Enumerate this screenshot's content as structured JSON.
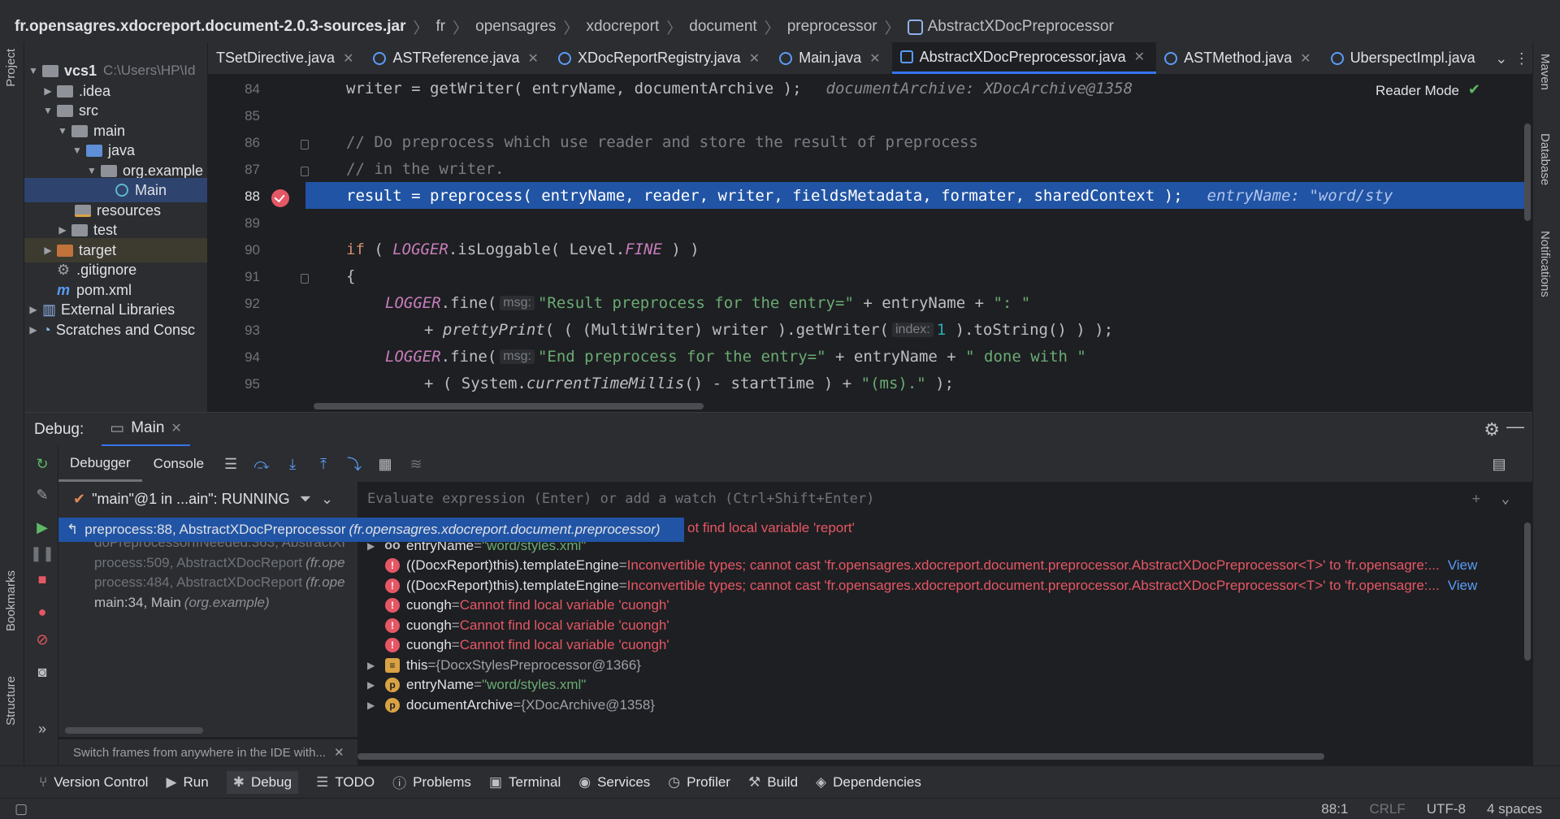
{
  "breadcrumb": {
    "items": [
      "fr.opensagres.xdocreport.document-2.0.3-sources.jar",
      "fr",
      "opensagres",
      "xdocreport",
      "document",
      "preprocessor",
      "AbstractXDocPreprocessor"
    ]
  },
  "left_strip": {
    "project_label": "Project",
    "bookmarks_label": "Bookmarks",
    "structure_label": "Structure"
  },
  "right_strip": {
    "maven_label": "Maven",
    "database_label": "Database",
    "notifications_label": "Notifications"
  },
  "project_tree": {
    "root_name": "vcs1",
    "root_path": "C:\\Users\\HP\\Id",
    "items": {
      "idea": ".idea",
      "src": "src",
      "main": "main",
      "java": "java",
      "org_example": "org.example",
      "main_class": "Main",
      "resources": "resources",
      "test": "test",
      "target": "target",
      "gitignore": ".gitignore",
      "pom": "pom.xml",
      "external_libraries": "External Libraries",
      "scratches": "Scratches and Consc"
    }
  },
  "editor_tabs": [
    {
      "label": "TSetDirective.java",
      "active": false
    },
    {
      "label": "ASTReference.java",
      "active": false
    },
    {
      "label": "XDocReportRegistry.java",
      "active": false
    },
    {
      "label": "Main.java",
      "active": false
    },
    {
      "label": "AbstractXDocPreprocessor.java",
      "active": true
    },
    {
      "label": "ASTMethod.java",
      "active": false
    },
    {
      "label": "UberspectImpl.java",
      "active": false
    }
  ],
  "editor": {
    "reader_mode": "Reader Mode",
    "line_numbers": [
      "84",
      "85",
      "86",
      "87",
      "88",
      "89",
      "90",
      "91",
      "92",
      "93",
      "94",
      "95"
    ],
    "current_line": "88",
    "lines": {
      "l84_code": "writer = getWriter( entryName, documentArchive );",
      "l84_inline": "documentArchive: XDocArchive@1358",
      "l86_comment": "// Do preprocess which use reader and store the result of preprocess",
      "l87_comment": "// in the writer.",
      "l88_code": "result = preprocess( entryName, reader, writer, fieldsMetadata, formater, sharedContext );",
      "l88_inline": "entryName: \"word/sty",
      "l90_if": "if",
      "l90_logger": "LOGGER",
      "l90_rest": ".isLoggable( Level.",
      "l90_fine": "FINE",
      "l90_end": " ) )",
      "l91_brace": "{",
      "l92_logger": "LOGGER",
      "l92_call": ".fine(",
      "l92_hint": "msg:",
      "l92_str": "\"Result preprocess for the entry=\"",
      "l92_rest": " + entryName + ",
      "l92_str2": "\": \"",
      "l93_plus": "+ ",
      "l93_method": "prettyPrint",
      "l93_rest": "( ( (MultiWriter) writer ).getWriter(",
      "l93_hint": "index:",
      "l93_num": "1",
      "l93_end": " ).toString() ) );",
      "l94_logger": "LOGGER",
      "l94_call": ".fine(",
      "l94_hint": "msg:",
      "l94_str": "\"End preprocess for the entry=\"",
      "l94_rest": " + entryName + ",
      "l94_str2": "\" done with \"",
      "l95_plus": "+ ( System.",
      "l95_method": "currentTimeMillis",
      "l95_rest": "() - startTime ) + ",
      "l95_str": "\"(ms).\"",
      "l95_end": " );"
    }
  },
  "debug": {
    "title": "Debug:",
    "tab_label": "Main",
    "tabs": {
      "debugger": "Debugger",
      "console": "Console"
    },
    "thread": "\"main\"@1 in ...ain\": RUNNING",
    "eval_placeholder": "Evaluate expression (Enter) or add a watch (Ctrl+Shift+Enter)",
    "frames": [
      {
        "method": "preprocess:88, AbstractXDocPreprocessor",
        "pkg": "(fr.opensagres.xdocreport.document.preprocessor)"
      },
      {
        "method": "doPreprocessorIfNeeded:363, AbstractXI",
        "pkg": ""
      },
      {
        "method": "process:509, AbstractXDocReport",
        "pkg": "(fr.ope"
      },
      {
        "method": "process:484, AbstractXDocReport",
        "pkg": "(fr.ope"
      },
      {
        "method": "main:34, Main",
        "pkg": "(org.example)"
      }
    ],
    "frames_hint": "Switch frames from anywhere in the IDE with...",
    "top_error": "ot find local variable 'report'",
    "variables": [
      {
        "name": "entryName",
        "eq": " = ",
        "value": "\"word/styles.xml\"",
        "kind": "watch"
      },
      {
        "name": "((DocxReport)this).templateEngine",
        "eq": " = ",
        "value": "Inconvertible types; cannot cast 'fr.opensagres.xdocreport.document.preprocessor.AbstractXDocPreprocessor<T>' to 'fr.opensagre:...",
        "kind": "error",
        "link": "View"
      },
      {
        "name": "((DocxReport)this).templateEngine",
        "eq": " = ",
        "value": "Inconvertible types; cannot cast 'fr.opensagres.xdocreport.document.preprocessor.AbstractXDocPreprocessor<T>' to 'fr.opensagre:...",
        "kind": "error",
        "link": "View"
      },
      {
        "name": "cuongh",
        "eq": " = ",
        "value": "Cannot find local variable 'cuongh'",
        "kind": "error"
      },
      {
        "name": "cuongh",
        "eq": " = ",
        "value": "Cannot find local variable 'cuongh'",
        "kind": "error"
      },
      {
        "name": "cuongh",
        "eq": " = ",
        "value": "Cannot find local variable 'cuongh'",
        "kind": "error"
      },
      {
        "name": "this",
        "eq": " = ",
        "value": "{DocxStylesPreprocessor@1366}",
        "kind": "field"
      },
      {
        "name": "entryName",
        "eq": " = ",
        "value": "\"word/styles.xml\"",
        "kind": "param"
      },
      {
        "name": "documentArchive",
        "eq": " = ",
        "value": "{XDocArchive@1358}",
        "kind": "param"
      }
    ]
  },
  "tool_windows": [
    "Version Control",
    "Run",
    "Debug",
    "TODO",
    "Problems",
    "Terminal",
    "Services",
    "Profiler",
    "Build",
    "Dependencies"
  ],
  "status": {
    "position": "88:1",
    "line_sep": "CRLF",
    "encoding": "UTF-8",
    "indent": "4 spaces"
  },
  "colors": {
    "accent": "#3574f0",
    "exec_line": "#2154a4",
    "error": "#e55765",
    "string": "#6aab73",
    "keyword": "#cf8e6d"
  }
}
